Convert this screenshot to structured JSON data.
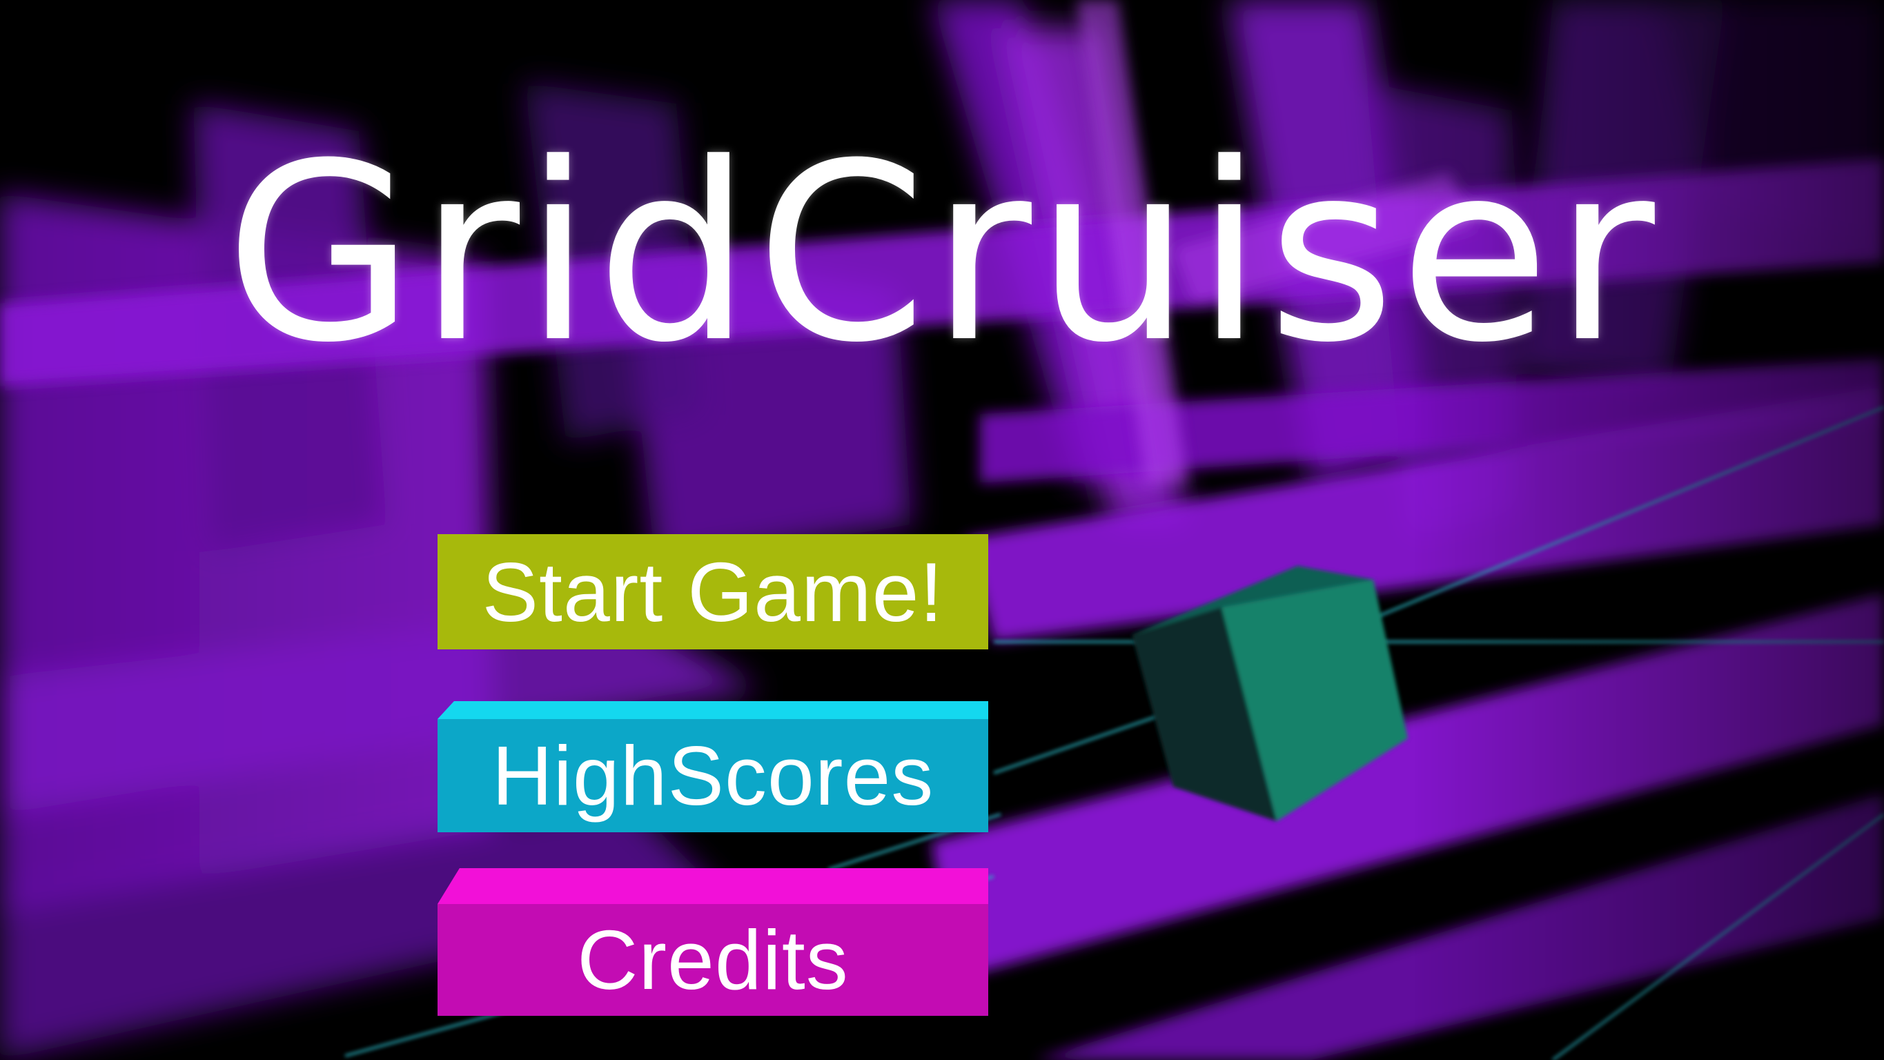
{
  "game": {
    "title": "GridCruiser"
  },
  "menu": {
    "start_label": "Start Game!",
    "highscores_label": "HighScores",
    "credits_label": "Credits"
  },
  "colors": {
    "background": "#000000",
    "grid_purple": "#8a12d6",
    "grid_purple_light": "#a22be8",
    "cube_teal": "#15826a",
    "line_cyan": "#2ab7c4",
    "start_button": "#a7b90c",
    "highscores_button": "#0ca7c8",
    "highscores_button_top": "#14d8ef",
    "credits_button": "#c30cb3",
    "credits_button_top": "#f210d8",
    "text": "#ffffff"
  }
}
